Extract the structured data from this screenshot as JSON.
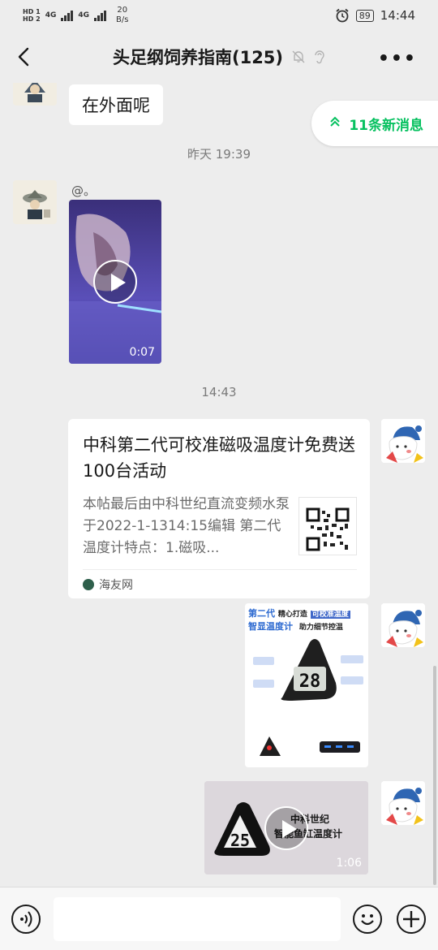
{
  "status_bar": {
    "hd1": "HD 1",
    "hd2": "HD 2",
    "net1": "4G",
    "net2": "4G",
    "speed_value": "20",
    "speed_unit": "B/s",
    "battery": "89",
    "time": "14:44"
  },
  "header": {
    "title": "头足纲饲养指南(125)",
    "more": "•••"
  },
  "chat": {
    "new_messages": "11条新消息",
    "messages": [
      {
        "text": "在外面呢"
      }
    ],
    "timestamp_1": "昨天 19:39",
    "mention": "@。",
    "video_1_duration": "0:07",
    "timestamp_2": "14:43",
    "link_card": {
      "title": "中科第二代可校准磁吸温度计免费送100台活动",
      "description": "本帖最后由中科世纪直流变频水泵于2022-1-1314:15编辑 第二代温度计特点：1.磁吸...",
      "source": "海友网"
    },
    "image_poster": {
      "line1_a": "第二代",
      "line1_b": "精心打造",
      "line1_c": "可校准温度",
      "line2_a": "智显温度计",
      "line2_b": "助力细节控温",
      "reading": "28"
    },
    "video_2": {
      "brand": "中科世纪",
      "product": "智能鱼缸温度计",
      "reading": "25",
      "duration": "1:06"
    }
  },
  "colors": {
    "background": "#ededed",
    "accent_green": "#07c160",
    "bubble": "#ffffff"
  }
}
